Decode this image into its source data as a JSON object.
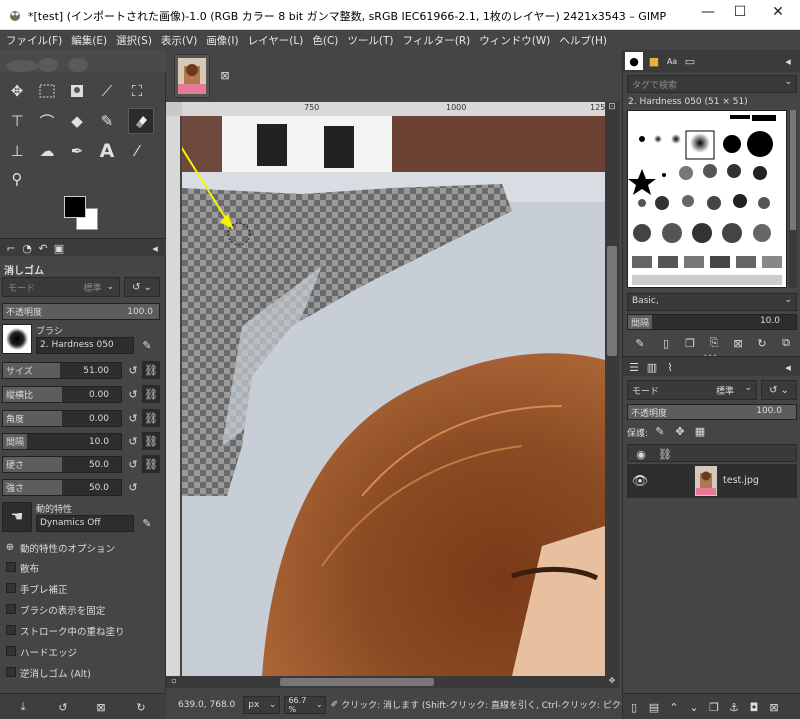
{
  "window": {
    "title": "*[test] (インポートされた画像)-1.0 (RGB カラー 8 bit ガンマ整数, sRGB IEC61966-2.1, 1枚のレイヤー) 2421x3543 – GIMP",
    "minimize": "—",
    "maximize": "☐",
    "close": "✕"
  },
  "menu": [
    "ファイル(F)",
    "編集(E)",
    "選択(S)",
    "表示(V)",
    "画像(I)",
    "レイヤー(L)",
    "色(C)",
    "ツール(T)",
    "フィルター(R)",
    "ウィンドウ(W)",
    "ヘルプ(H)"
  ],
  "tool_options": {
    "title": "消しゴム",
    "mode_label": "モード",
    "mode_value": "標準",
    "opacity_label": "不透明度",
    "opacity_value": "100.0",
    "brush_label": "ブラシ",
    "brush_value": "2. Hardness 050",
    "size_label": "サイズ",
    "size_value": "51.00",
    "aspect_label": "縦横比",
    "aspect_value": "0.00",
    "angle_label": "角度",
    "angle_value": "0.00",
    "spacing_label": "間隔",
    "spacing_value": "10.0",
    "hardness_label": "硬さ",
    "hardness_value": "50.0",
    "force_label": "強さ",
    "force_value": "50.0",
    "dynamics_label": "動的特性",
    "dynamics_value": "Dynamics Off",
    "dynamics_options": "動的特性のオプション",
    "scatter": "散布",
    "smoothing": "手ブレ補正",
    "lock_brush": "ブラシの表示を固定",
    "incremental": "ストローク中の重ね塗り",
    "hard_edge": "ハードエッジ",
    "anti_erase": "逆消しゴム (Alt)"
  },
  "ruler": {
    "t1": "750",
    "t2": "1000",
    "t3": "125"
  },
  "status": {
    "coords": "639.0, 768.0",
    "unit": "px",
    "zoom": "66.7 %",
    "message": "クリック: 消します (Shift-クリック: 直線を引く, Ctrl-クリック: ピクセ..."
  },
  "brushes": {
    "filter_placeholder": "タグで検索",
    "current": "2. Hardness 050 (51 × 51)",
    "preset": "Basic,",
    "spacing_label": "間隔",
    "spacing_value": "10.0"
  },
  "layers": {
    "mode_label": "モード",
    "mode_value": "標準",
    "opacity_label": "不透明度",
    "opacity_value": "100.0",
    "lock_label": "保護:",
    "layer_name": "test.jpg"
  }
}
